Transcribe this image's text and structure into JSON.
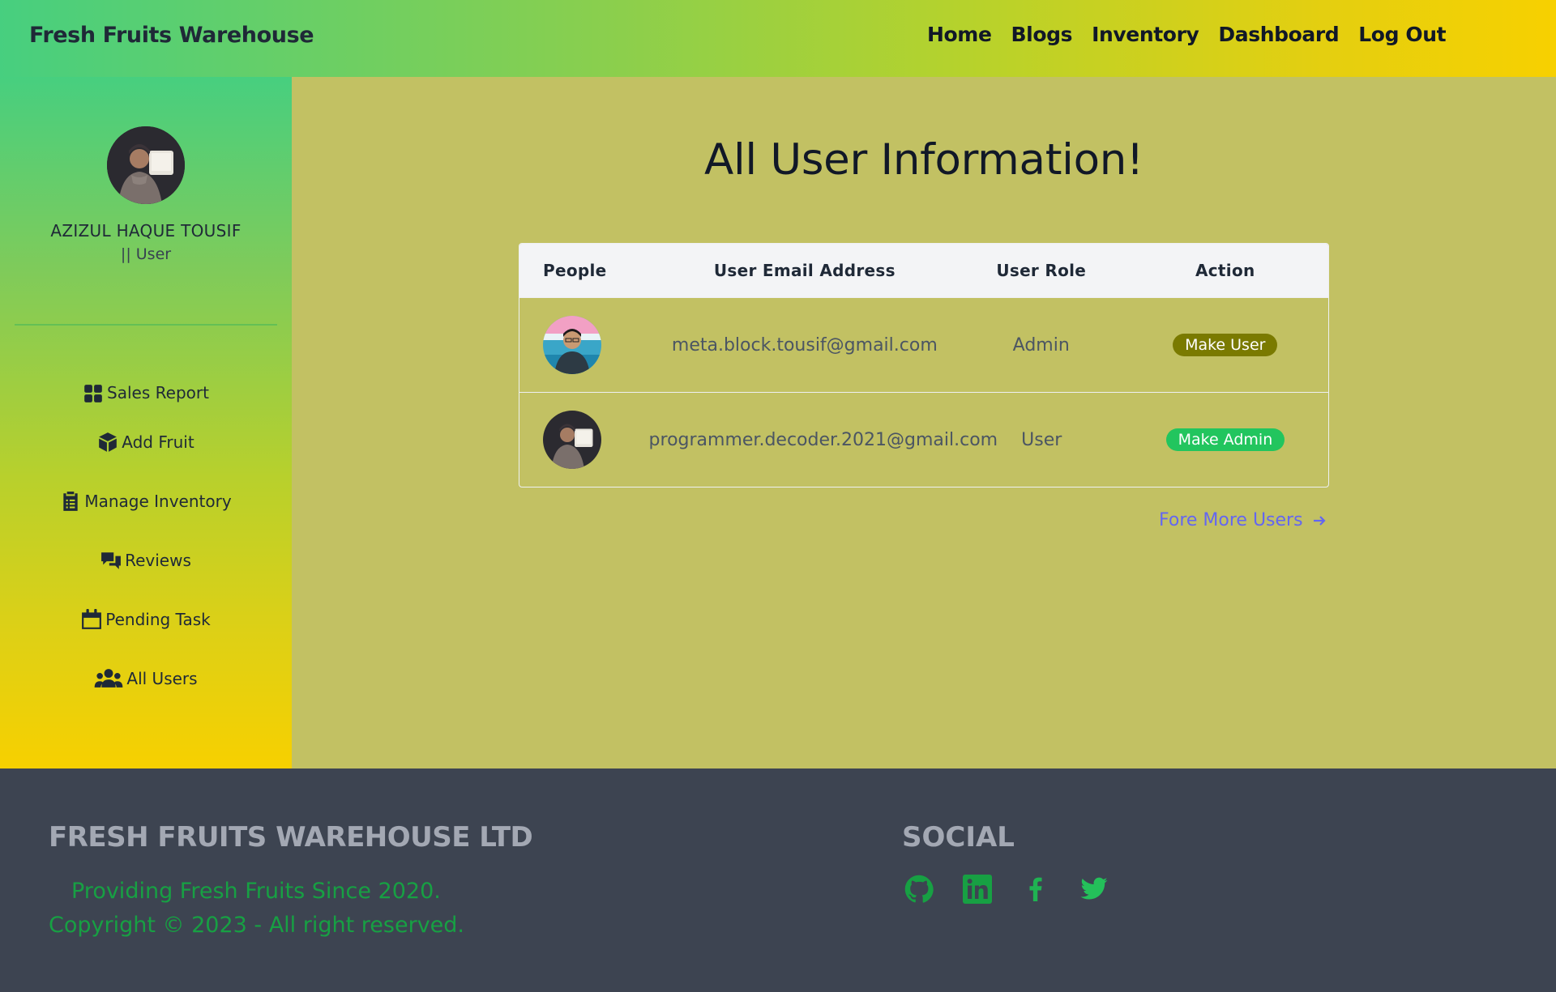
{
  "navbar": {
    "brand": "Fresh Fruits Warehouse",
    "links": [
      "Home",
      "Blogs",
      "Inventory",
      "Dashboard",
      "Log Out"
    ]
  },
  "sidebar": {
    "profile": {
      "name": "AZIZUL HAQUE TOUSIF",
      "role": "|| User"
    },
    "items": [
      {
        "label": "Sales Report",
        "icon": "grid-icon"
      },
      {
        "label": "Add Fruit",
        "icon": "box-icon"
      },
      {
        "label": "Manage Inventory",
        "icon": "clipboard-icon"
      },
      {
        "label": "Reviews",
        "icon": "comments-icon"
      },
      {
        "label": "Pending Task",
        "icon": "calendar-icon"
      },
      {
        "label": "All Users",
        "icon": "users-icon"
      }
    ]
  },
  "main": {
    "title": "All User Information!",
    "table": {
      "headers": [
        "People",
        "User Email Address",
        "User Role",
        "Action"
      ],
      "rows": [
        {
          "email": "meta.block.tousif@gmail.com",
          "role": "Admin",
          "action": "Make User"
        },
        {
          "email": "programmer.decoder.2021@gmail.com",
          "role": "User",
          "action": "Make Admin"
        }
      ]
    },
    "more_link": "Fore More Users"
  },
  "footer": {
    "brand": "FRESH FRUITS WAREHOUSE LTD",
    "tagline": "Providing Fresh Fruits Since 2020.",
    "copyright": "Copyright © 2023 - All right reserved.",
    "social_title": "SOCIAL",
    "social": [
      "github-icon",
      "linkedin-icon",
      "facebook-icon",
      "twitter-icon"
    ]
  },
  "colors": {
    "main_bg": "#c2c163",
    "footer_bg": "#3d4451",
    "make_user": "#7a7a00",
    "make_admin": "#22c55e",
    "link": "#6366f1",
    "footer_green": "#17a043"
  }
}
